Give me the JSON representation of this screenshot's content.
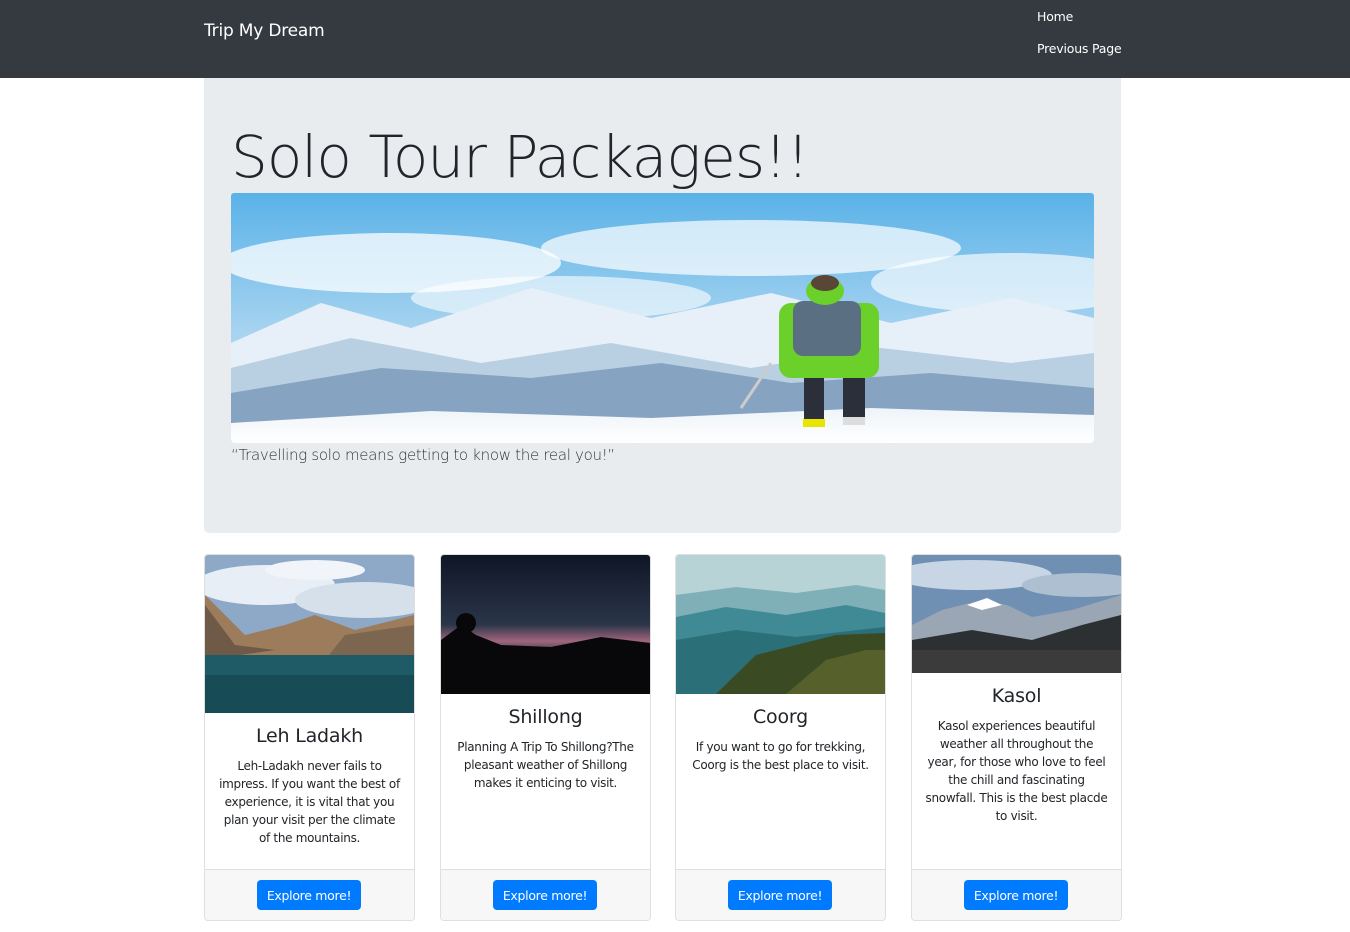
{
  "navbar": {
    "brand": "Trip My Dream",
    "links": [
      {
        "label": "Home"
      },
      {
        "label": "Previous Page"
      }
    ]
  },
  "jumbotron": {
    "title": "Solo Tour Packages!!",
    "hero_image": "solo-hiker-snowy-mountains",
    "quote": "“Travelling solo means getting to know the real you!”"
  },
  "cards": [
    {
      "image": "leh-ladakh-lake-mountains",
      "title": "Leh Ladakh",
      "text": "Leh-Ladakh never fails to impress. If you want the best of experience, it is vital that you plan your visit per the climate of the mountains.",
      "button": "Explore more!"
    },
    {
      "image": "shillong-sunset-silhouette",
      "title": "Shillong",
      "text": "Planning A Trip To Shillong?The pleasant weather of Shillong makes it enticing to visit.",
      "button": "Explore more!"
    },
    {
      "image": "coorg-misty-hills",
      "title": "Coorg",
      "text": "If you want to go for trekking, Coorg is the best place to visit.",
      "button": "Explore more!"
    },
    {
      "image": "kasol-snow-peaks",
      "title": "Kasol",
      "text": "Kasol experiences beautiful weather all throughout the year, for those who love to feel the chill and fascinating snowfall. This is the best placde to visit.",
      "button": "Explore more!"
    }
  ],
  "colors": {
    "navbar_bg": "#343a40",
    "jumbotron_bg": "#e9ecef",
    "button_bg": "#007bff"
  }
}
